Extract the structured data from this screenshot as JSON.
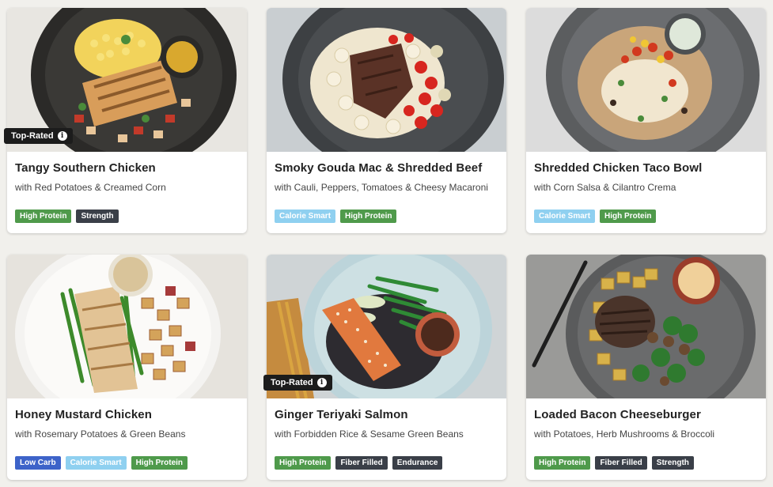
{
  "colors": {
    "page_bg": "#f1f0ec",
    "tag_high_protein": "#4f9a4b",
    "tag_strength": "#3a3f48",
    "tag_calorie_smart": "#8fd0f0",
    "tag_low_carb": "#3d63c9",
    "tag_fiber_filled": "#3a3f48",
    "tag_endurance": "#3a3f48",
    "badge_bg": "#1c1c1c"
  },
  "meals": [
    {
      "title": "Tangy Southern Chicken",
      "subtitle": "with Red Potatoes & Creamed Corn",
      "badge": "Top-Rated",
      "tags": [
        {
          "label": "High Protein",
          "color": "#4f9a4b"
        },
        {
          "label": "Strength",
          "color": "#3a3f48"
        }
      ]
    },
    {
      "title": "Smoky Gouda Mac & Shredded Beef",
      "subtitle": "with Cauli, Peppers, Tomatoes & Cheesy Macaroni",
      "badge": "",
      "tags": [
        {
          "label": "Calorie Smart",
          "color": "#8fd0f0"
        },
        {
          "label": "High Protein",
          "color": "#4f9a4b"
        }
      ]
    },
    {
      "title": "Shredded Chicken Taco Bowl",
      "subtitle": "with Corn Salsa & Cilantro Crema",
      "badge": "",
      "tags": [
        {
          "label": "Calorie Smart",
          "color": "#8fd0f0"
        },
        {
          "label": "High Protein",
          "color": "#4f9a4b"
        }
      ]
    },
    {
      "title": "Honey Mustard Chicken",
      "subtitle": "with Rosemary Potatoes & Green Beans",
      "badge": "",
      "tags": [
        {
          "label": "Low Carb",
          "color": "#3d63c9"
        },
        {
          "label": "Calorie Smart",
          "color": "#8fd0f0"
        },
        {
          "label": "High Protein",
          "color": "#4f9a4b"
        }
      ]
    },
    {
      "title": "Ginger Teriyaki Salmon",
      "subtitle": "with Forbidden Rice & Sesame Green Beans",
      "badge": "Top-Rated",
      "tags": [
        {
          "label": "High Protein",
          "color": "#4f9a4b"
        },
        {
          "label": "Fiber Filled",
          "color": "#3a3f48"
        },
        {
          "label": "Endurance",
          "color": "#3a3f48"
        }
      ]
    },
    {
      "title": "Loaded Bacon Cheeseburger",
      "subtitle": "with Potatoes, Herb Mushrooms & Broccoli",
      "badge": "",
      "tags": [
        {
          "label": "High Protein",
          "color": "#4f9a4b"
        },
        {
          "label": "Fiber Filled",
          "color": "#3a3f48"
        },
        {
          "label": "Strength",
          "color": "#3a3f48"
        }
      ]
    }
  ],
  "badge_info_icon": "info-icon"
}
